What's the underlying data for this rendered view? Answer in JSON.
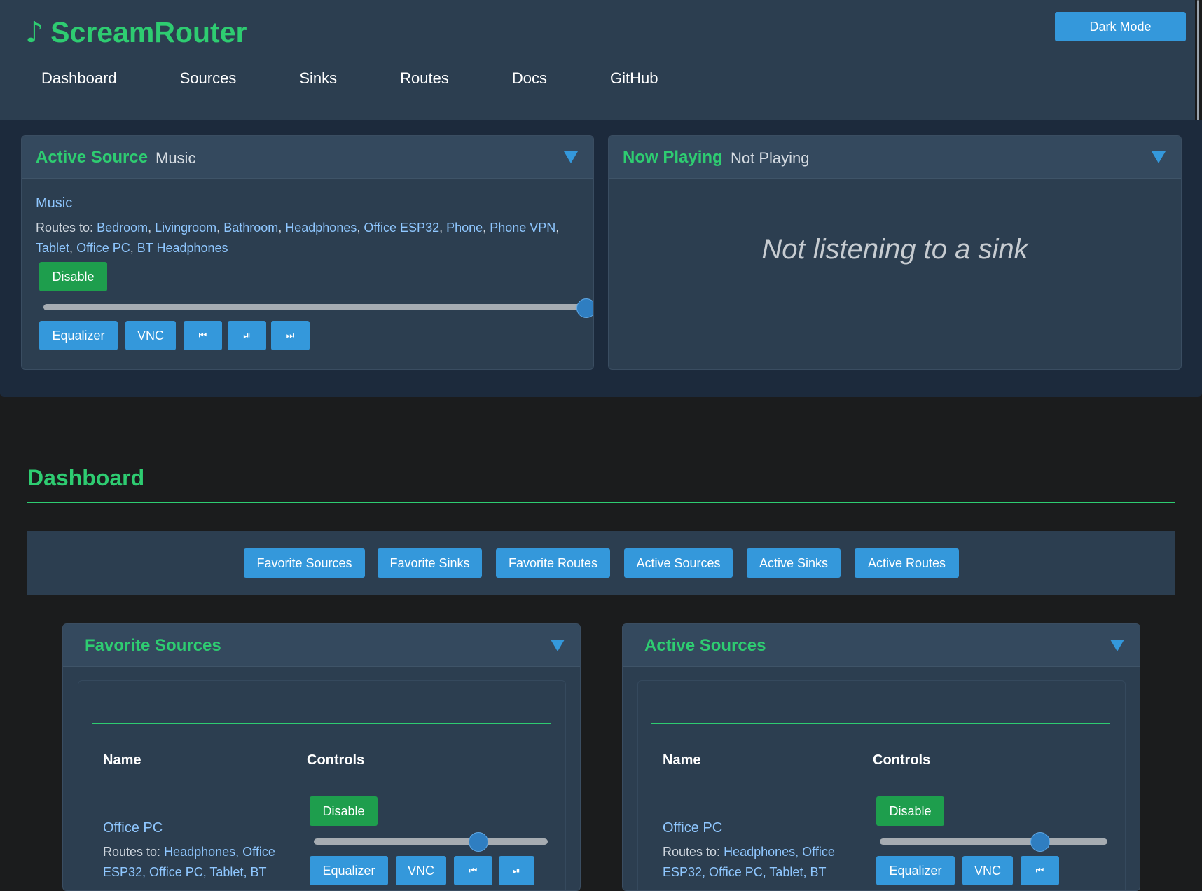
{
  "header": {
    "logo_icon": "music-note-icon",
    "logo_glyph": "♪",
    "title": "ScreamRouter",
    "dark_mode_label": "Dark Mode",
    "nav": [
      "Dashboard",
      "Sources",
      "Sinks",
      "Routes",
      "Docs",
      "GitHub"
    ]
  },
  "active_source": {
    "title": "Active Source",
    "subtitle": "Music",
    "name": "Music",
    "routes_prefix": "Routes to:",
    "routes": [
      "Bedroom",
      "Livingroom",
      "Bathroom",
      "Headphones",
      "Office ESP32",
      "Phone",
      "Phone VPN",
      "Tablet",
      "Office PC",
      "BT Headphones"
    ],
    "disable_label": "Disable",
    "volume_fraction": 1.0,
    "equalizer_label": "Equalizer",
    "vnc_label": "VNC",
    "prev_glyph": "⏮",
    "playpause_glyph": "⏯",
    "next_glyph": "⏭"
  },
  "now_playing": {
    "title": "Now Playing",
    "subtitle": "Not Playing",
    "message": "Not listening to a sink"
  },
  "dashboard": {
    "title": "Dashboard",
    "filters": [
      "Favorite Sources",
      "Favorite Sinks",
      "Favorite Routes",
      "Active Sources",
      "Active Sinks",
      "Active Routes"
    ]
  },
  "favorite_sources": {
    "title": "Favorite Sources",
    "col_name": "Name",
    "col_controls": "Controls",
    "row": {
      "name": "Office PC",
      "routes_prefix": "Routes to:",
      "routes_line1": "Headphones, Office",
      "routes_line2": "ESP32, Office PC, Tablet, BT",
      "disable_label": "Disable",
      "volume_fraction": 0.7,
      "equalizer_label": "Equalizer",
      "vnc_label": "VNC",
      "prev_glyph": "⏮",
      "playpause_glyph": "⏯"
    }
  },
  "active_sources": {
    "title": "Active Sources",
    "col_name": "Name",
    "col_controls": "Controls",
    "row": {
      "name": "Office PC",
      "routes_prefix": "Routes to:",
      "routes_line1": "Headphones, Office",
      "routes_line2": "ESP32, Office PC, Tablet, BT",
      "disable_label": "Disable",
      "volume_fraction": 0.7,
      "equalizer_label": "Equalizer",
      "vnc_label": "VNC",
      "prev_glyph": "⏮"
    }
  },
  "colors": {
    "accent_green": "#2ecc71",
    "button_blue": "#3498db",
    "button_green": "#1e9e4d",
    "header_bg": "#2c3e50"
  }
}
